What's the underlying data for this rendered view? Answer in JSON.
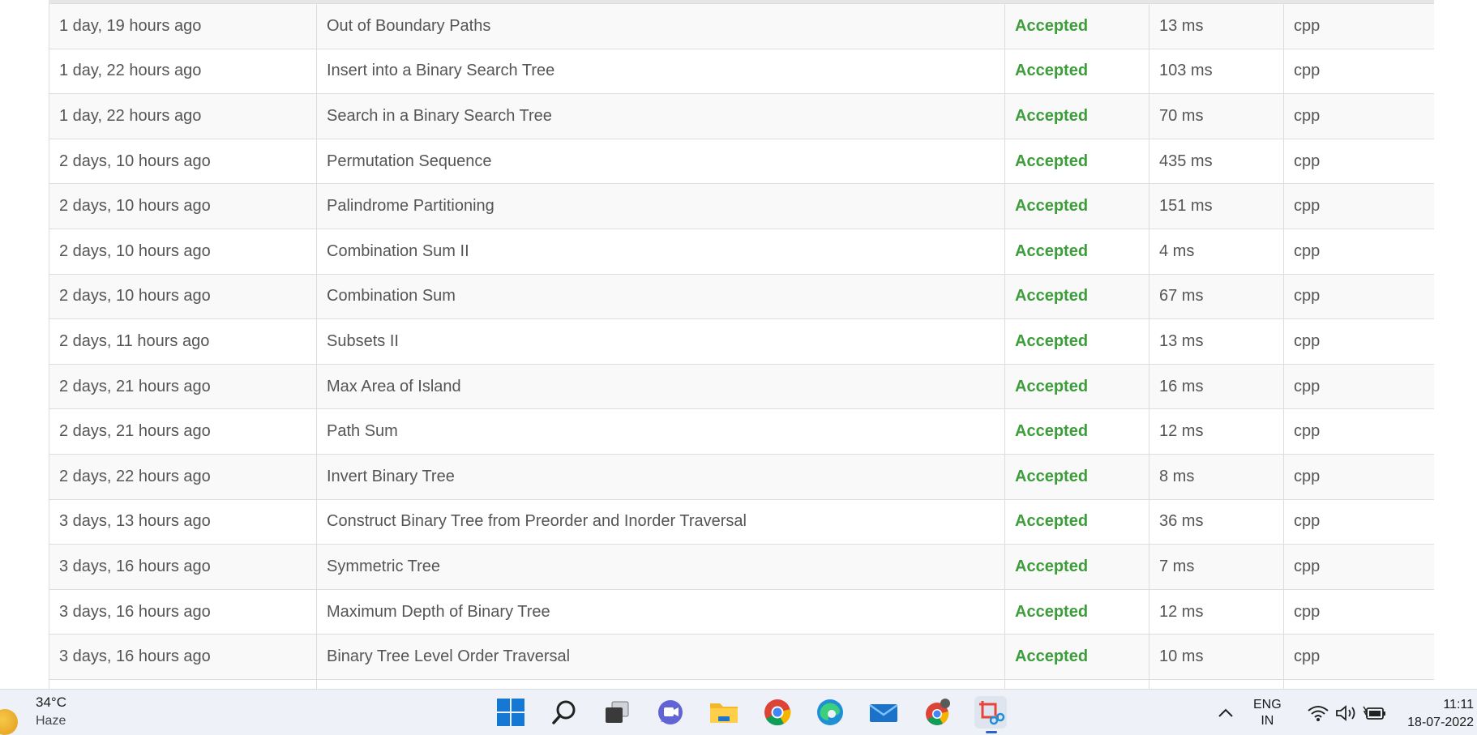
{
  "submissions": [
    {
      "time": "1 day, 19 hours ago",
      "problem": "Out of Boundary Paths",
      "status": "Accepted",
      "runtime": "13 ms",
      "lang": "cpp"
    },
    {
      "time": "1 day, 22 hours ago",
      "problem": "Insert into a Binary Search Tree",
      "status": "Accepted",
      "runtime": "103 ms",
      "lang": "cpp"
    },
    {
      "time": "1 day, 22 hours ago",
      "problem": "Search in a Binary Search Tree",
      "status": "Accepted",
      "runtime": "70 ms",
      "lang": "cpp"
    },
    {
      "time": "2 days, 10 hours ago",
      "problem": "Permutation Sequence",
      "status": "Accepted",
      "runtime": "435 ms",
      "lang": "cpp"
    },
    {
      "time": "2 days, 10 hours ago",
      "problem": "Palindrome Partitioning",
      "status": "Accepted",
      "runtime": "151 ms",
      "lang": "cpp"
    },
    {
      "time": "2 days, 10 hours ago",
      "problem": "Combination Sum II",
      "status": "Accepted",
      "runtime": "4 ms",
      "lang": "cpp"
    },
    {
      "time": "2 days, 10 hours ago",
      "problem": "Combination Sum",
      "status": "Accepted",
      "runtime": "67 ms",
      "lang": "cpp"
    },
    {
      "time": "2 days, 11 hours ago",
      "problem": "Subsets II",
      "status": "Accepted",
      "runtime": "13 ms",
      "lang": "cpp"
    },
    {
      "time": "2 days, 21 hours ago",
      "problem": "Max Area of Island",
      "status": "Accepted",
      "runtime": "16 ms",
      "lang": "cpp"
    },
    {
      "time": "2 days, 21 hours ago",
      "problem": "Path Sum",
      "status": "Accepted",
      "runtime": "12 ms",
      "lang": "cpp"
    },
    {
      "time": "2 days, 22 hours ago",
      "problem": "Invert Binary Tree",
      "status": "Accepted",
      "runtime": "8 ms",
      "lang": "cpp"
    },
    {
      "time": "3 days, 13 hours ago",
      "problem": "Construct Binary Tree from Preorder and Inorder Traversal",
      "status": "Accepted",
      "runtime": "36 ms",
      "lang": "cpp"
    },
    {
      "time": "3 days, 16 hours ago",
      "problem": "Symmetric Tree",
      "status": "Accepted",
      "runtime": "7 ms",
      "lang": "cpp"
    },
    {
      "time": "3 days, 16 hours ago",
      "problem": "Maximum Depth of Binary Tree",
      "status": "Accepted",
      "runtime": "12 ms",
      "lang": "cpp"
    },
    {
      "time": "3 days, 16 hours ago",
      "problem": "Binary Tree Level Order Traversal",
      "status": "Accepted",
      "runtime": "10 ms",
      "lang": "cpp"
    }
  ],
  "colors": {
    "accepted": "#3c9d3a",
    "text": "#555555",
    "row_odd": "#f9f9f9",
    "row_even": "#ffffff",
    "border": "#dddddd",
    "taskbar": "#eef2f8"
  },
  "taskbar": {
    "weather": {
      "temp": "34°C",
      "condition": "Haze",
      "icon": "sun-haze-icon"
    },
    "apps": [
      {
        "name": "windows-start-icon",
        "active": false
      },
      {
        "name": "search-icon",
        "active": false
      },
      {
        "name": "task-view-icon",
        "active": false
      },
      {
        "name": "teams-chat-icon",
        "active": false
      },
      {
        "name": "file-explorer-icon",
        "active": false
      },
      {
        "name": "chrome-icon",
        "active": false
      },
      {
        "name": "edge-icon",
        "active": false
      },
      {
        "name": "mail-icon",
        "active": false
      },
      {
        "name": "chrome-profile-icon",
        "active": false
      },
      {
        "name": "snipping-tool-icon",
        "active": true
      }
    ],
    "tray": {
      "lang_line1": "ENG",
      "lang_line2": "IN",
      "icons": [
        "chevron-up-icon",
        "wifi-icon",
        "volume-icon",
        "battery-icon"
      ],
      "time": "11:11",
      "date": "18-07-2022"
    }
  }
}
